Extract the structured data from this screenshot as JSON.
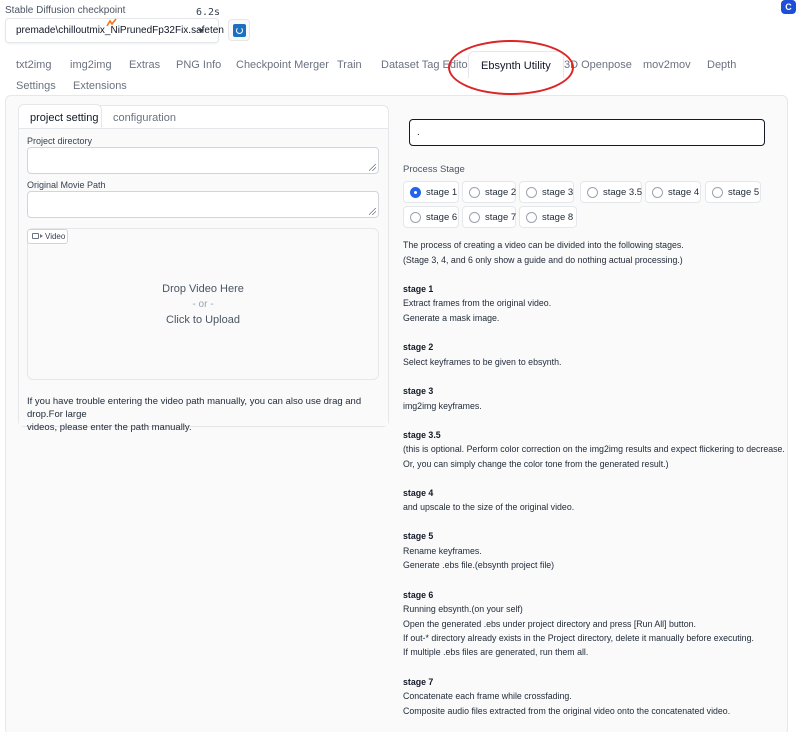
{
  "checkpoint": {
    "label": "Stable Diffusion checkpoint",
    "value": "premade\\chilloutmix_NiPrunedFp32Fix.safeten",
    "timer": "6.2s"
  },
  "corner_badge": "C",
  "tabs": [
    {
      "label": "txt2img"
    },
    {
      "label": "img2img"
    },
    {
      "label": "Extras"
    },
    {
      "label": "PNG Info"
    },
    {
      "label": "Checkpoint Merger"
    },
    {
      "label": "Train"
    },
    {
      "label": "Dataset Tag Editor"
    },
    {
      "label": "Ebsynth Utility"
    },
    {
      "label": "3D Openpose"
    },
    {
      "label": "mov2mov"
    },
    {
      "label": "Depth"
    },
    {
      "label": "Settings"
    },
    {
      "label": "Extensions"
    }
  ],
  "active_tab": "Ebsynth Utility",
  "left": {
    "subtabs": [
      {
        "label": "project setting"
      },
      {
        "label": "configuration"
      }
    ],
    "project_directory_label": "Project directory",
    "project_directory_value": "",
    "movie_path_label": "Original Movie Path",
    "movie_path_value": "",
    "video_chip_label": "Video",
    "drop_text": "Drop Video Here",
    "or_text": "- or -",
    "upload_text": "Click to Upload",
    "help_line1": "If you have trouble entering the video path manually, you can also use drag and drop.For large",
    "help_line2": "videos, please enter the path manually."
  },
  "right": {
    "output_value": ".",
    "stage_label": "Process Stage",
    "stages": [
      {
        "label": "stage 1",
        "selected": true
      },
      {
        "label": "stage 2",
        "selected": false
      },
      {
        "label": "stage 3",
        "selected": false
      },
      {
        "label": "stage 3.5",
        "selected": false
      },
      {
        "label": "stage 4",
        "selected": false
      },
      {
        "label": "stage 5",
        "selected": false
      },
      {
        "label": "stage 6",
        "selected": false
      },
      {
        "label": "stage 7",
        "selected": false
      },
      {
        "label": "stage 8",
        "selected": false
      }
    ],
    "description": [
      {
        "text": "The process of creating a video can be divided into the following stages.",
        "bold": false
      },
      {
        "text": "(Stage 3, 4, and 6 only show a guide and do nothing actual processing.)",
        "bold": false
      },
      {
        "text": "stage 1",
        "bold": true
      },
      {
        "text": "Extract frames from the original video.",
        "bold": false
      },
      {
        "text": "Generate a mask image.",
        "bold": false
      },
      {
        "text": "stage 2",
        "bold": true
      },
      {
        "text": "Select keyframes to be given to ebsynth.",
        "bold": false
      },
      {
        "text": "stage 3",
        "bold": true
      },
      {
        "text": "img2img keyframes.",
        "bold": false
      },
      {
        "text": "stage 3.5",
        "bold": true
      },
      {
        "text": "(this is optional. Perform color correction on the img2img results and expect flickering to decrease.",
        "bold": false
      },
      {
        "text": "Or, you can simply change the color tone from the generated result.)",
        "bold": false
      },
      {
        "text": "stage 4",
        "bold": true
      },
      {
        "text": "and upscale to the size of the original video.",
        "bold": false
      },
      {
        "text": "stage 5",
        "bold": true
      },
      {
        "text": "Rename keyframes.",
        "bold": false
      },
      {
        "text": "Generate .ebs file.(ebsynth project file)",
        "bold": false
      },
      {
        "text": "stage 6",
        "bold": true
      },
      {
        "text": "Running ebsynth.(on your self)",
        "bold": false
      },
      {
        "text": "Open the generated .ebs under project directory and press [Run All] button.",
        "bold": false
      },
      {
        "text": "If out-* directory already exists in the Project directory, delete it manually before executing.",
        "bold": false
      },
      {
        "text": "If multiple .ebs files are generated, run them all.",
        "bold": false
      },
      {
        "text": "stage 7",
        "bold": true
      },
      {
        "text": "Concatenate each frame while crossfading.",
        "bold": false
      },
      {
        "text": "Composite audio files extracted from the original video onto the concatenated video.",
        "bold": false
      }
    ]
  },
  "colors": {
    "accent": "#2563eb",
    "annotation": "#dc2626"
  }
}
